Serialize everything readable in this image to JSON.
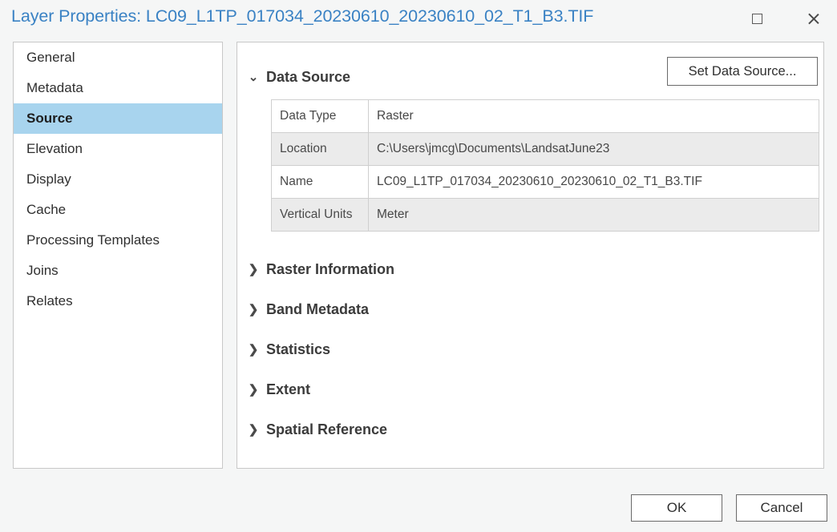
{
  "window": {
    "title": "Layer Properties: LC09_L1TP_017034_20230610_20230610_02_T1_B3.TIF",
    "maximize_icon": "maximize-icon",
    "close_icon": "close-icon"
  },
  "sidebar": {
    "items": [
      {
        "label": "General",
        "selected": false
      },
      {
        "label": "Metadata",
        "selected": false
      },
      {
        "label": "Source",
        "selected": true
      },
      {
        "label": "Elevation",
        "selected": false
      },
      {
        "label": "Display",
        "selected": false
      },
      {
        "label": "Cache",
        "selected": false
      },
      {
        "label": "Processing Templates",
        "selected": false
      },
      {
        "label": "Joins",
        "selected": false
      },
      {
        "label": "Relates",
        "selected": false
      }
    ]
  },
  "content": {
    "data_source": {
      "header_label": "Data Source",
      "expanded": true,
      "chevron": "⌄",
      "set_button_label": "Set Data Source...",
      "rows": [
        {
          "label": "Data Type",
          "value": "Raster",
          "shaded": false
        },
        {
          "label": "Location",
          "value": "C:\\Users\\jmcg\\Documents\\LandsatJune23",
          "shaded": true
        },
        {
          "label": "Name",
          "value": "LC09_L1TP_017034_20230610_20230610_02_T1_B3.TIF",
          "shaded": false
        },
        {
          "label": "Vertical Units",
          "value": "Meter",
          "shaded": true
        }
      ]
    },
    "collapsed_sections": [
      {
        "label": "Raster Information",
        "chevron": "❯"
      },
      {
        "label": "Band Metadata",
        "chevron": "❯"
      },
      {
        "label": "Statistics",
        "chevron": "❯"
      },
      {
        "label": "Extent",
        "chevron": "❯"
      },
      {
        "label": "Spatial Reference",
        "chevron": "❯"
      }
    ]
  },
  "footer": {
    "ok_label": "OK",
    "cancel_label": "Cancel"
  },
  "colors": {
    "title_blue": "#3a82c4",
    "selection_blue": "#a8d4ee",
    "dialog_bg": "#f5f6f6",
    "panel_bg": "#ffffff",
    "row_shaded": "#ebebeb",
    "border": "#c8c8c8"
  }
}
